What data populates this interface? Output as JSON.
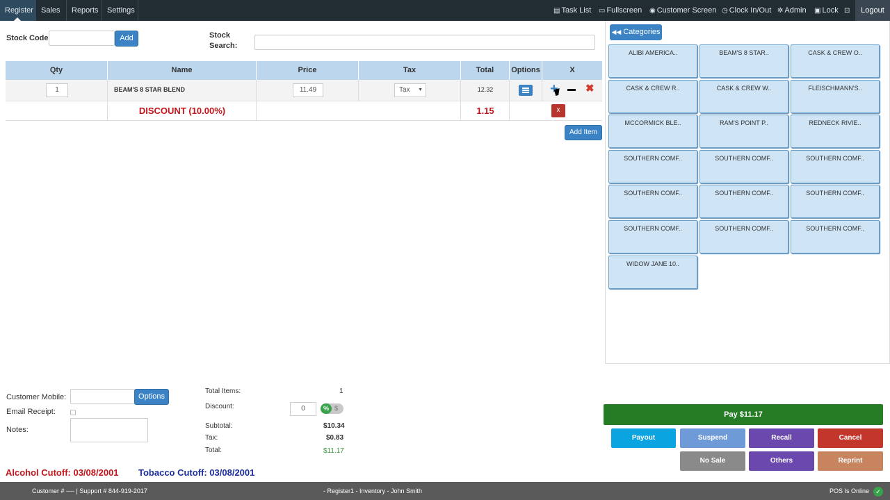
{
  "nav": {
    "tabs": [
      {
        "label": "Register"
      },
      {
        "label": "Sales"
      },
      {
        "label": "Reports"
      },
      {
        "label": "Settings"
      }
    ],
    "right": {
      "task_list": "Task List",
      "fullscreen": "Fullscreen",
      "customer_screen": "Customer Screen",
      "clock": "Clock In/Out",
      "admin": "Admin",
      "lock": "Lock",
      "logout": "Logout"
    }
  },
  "stock": {
    "code_label": "Stock Code:",
    "add_label": "Add",
    "search_label_1": "Stock",
    "search_label_2": "Search:"
  },
  "table": {
    "headers": [
      "Qty",
      "Name",
      "Price",
      "Tax",
      "Total",
      "Options",
      "X"
    ],
    "item": {
      "qty": "1",
      "name": "BEAM'S 8 STAR BLEND",
      "price": "11.49",
      "tax": "Tax",
      "total": "12.32"
    },
    "discount": {
      "label": "DISCOUNT (10.00%)",
      "amount": "1.15",
      "remove": "x"
    },
    "add_item_label": "Add Item"
  },
  "categories": {
    "button_label": "Categories",
    "tiles": [
      "ALIBI AMERICA..",
      "BEAM'S 8 STAR..",
      "CASK & CREW O..",
      "CASK & CREW R..",
      "CASK & CREW W..",
      "FLEISCHMANN'S..",
      "MCCORMICK BLE..",
      "RAM'S POINT P..",
      "REDNECK RIVIE..",
      "SOUTHERN COMF..",
      "SOUTHERN COMF..",
      "SOUTHERN COMF..",
      "SOUTHERN COMF..",
      "SOUTHERN COMF..",
      "SOUTHERN COMF..",
      "SOUTHERN COMF..",
      "SOUTHERN COMF..",
      "SOUTHERN COMF..",
      "WIDOW JANE 10.."
    ]
  },
  "customer": {
    "mobile_label": "Customer Mobile:",
    "options_label": "Options",
    "email_label": "Email Receipt:",
    "notes_label": "Notes:"
  },
  "totals": {
    "items_label": "Total Items:",
    "items_value": "1",
    "discount_label": "Discount:",
    "discount_value": "0",
    "discount_pct": "%",
    "discount_dollar": "$",
    "subtotal_label": "Subtotal:",
    "subtotal_value": "$10.34",
    "tax_label": "Tax:",
    "tax_value": "$0.83",
    "total_label": "Total:",
    "total_value": "$11.17"
  },
  "cutoffs": {
    "alcohol": "Alcohol Cutoff: 03/08/2001",
    "tobacco": "Tobacco Cutoff: 03/08/2001"
  },
  "actions": {
    "pay": "Pay $11.17",
    "payout": "Payout",
    "suspend": "Suspend",
    "recall": "Recall",
    "cancel": "Cancel",
    "no_sale": "No Sale",
    "others": "Others",
    "reprint": "Reprint"
  },
  "footer": {
    "left": "Customer # ---- | Support # 844-919-2017",
    "center": "- Register1 - Inventory - John Smith",
    "right": "POS Is Online"
  },
  "colors": {
    "nav_bg": "#222c33",
    "accent_blue": "#3b83c4",
    "pay_green": "#267c24",
    "payout": "#0aa4e0",
    "suspend": "#6e9ad8",
    "recall": "#6a48ae",
    "cancel": "#c2362c",
    "no_sale": "#8a8a8a",
    "others": "#6a48ae",
    "reprint": "#c7845e",
    "discount_red": "#c0161c",
    "tobacco_blue": "#1b2e9c"
  }
}
